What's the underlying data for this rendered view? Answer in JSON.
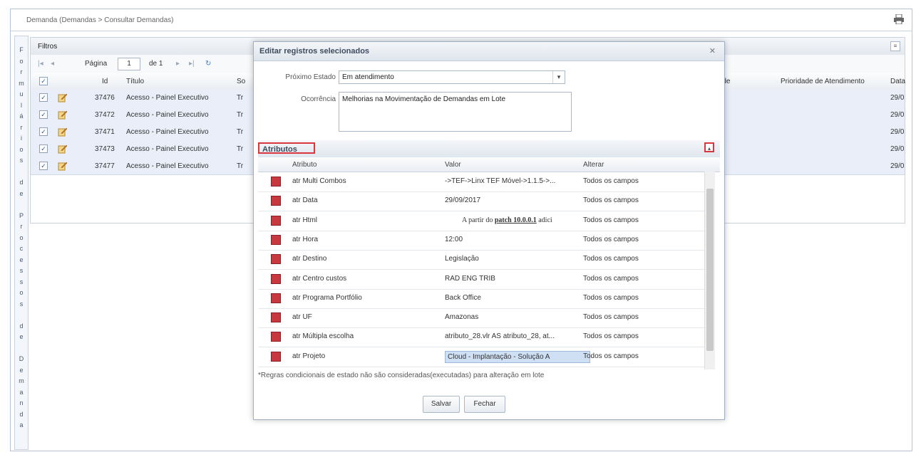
{
  "breadcrumb": "Demanda (Demandas > Consultar Demandas)",
  "vertical_label": [
    "F",
    "o",
    "r",
    "m",
    "u",
    "l",
    "á",
    "r",
    "i",
    "o",
    "s",
    "",
    "d",
    "e",
    "",
    "P",
    "r",
    "o",
    "c",
    "e",
    "s",
    "s",
    "o",
    "s",
    "",
    "d",
    "e",
    "",
    "D",
    "e",
    "m",
    "a",
    "n",
    "d",
    "a"
  ],
  "filters": {
    "title": "Filtros"
  },
  "paging": {
    "page_label": "Página",
    "page_value": "1",
    "of_label": "de 1"
  },
  "grid": {
    "headers": {
      "id": "Id",
      "title": "Título",
      "so": "So",
      "priority_short": "idade",
      "priority_attend": "Prioridade de Atendimento",
      "date": "Data"
    },
    "rows": [
      {
        "id": "37476",
        "title": "Acesso - Painel Executivo",
        "so": "Tr",
        "date": "29/0"
      },
      {
        "id": "37472",
        "title": "Acesso - Painel Executivo",
        "so": "Tr",
        "date": "29/0"
      },
      {
        "id": "37471",
        "title": "Acesso - Painel Executivo",
        "so": "Tr",
        "date": "29/0"
      },
      {
        "id": "37473",
        "title": "Acesso - Painel Executivo",
        "so": "Tr",
        "date": "29/0"
      },
      {
        "id": "37477",
        "title": "Acesso - Painel Executivo",
        "so": "Tr",
        "date": "29/0"
      }
    ]
  },
  "modal": {
    "title": "Editar registros selecionados",
    "next_state_label": "Próximo Estado",
    "next_state_value": "Em atendimento",
    "occurrence_label": "Ocorrência",
    "occurrence_value": "Melhorias na Movimentação de Demandas em Lote",
    "attributes_title": "Atributos",
    "attr_headers": {
      "attribute": "Atributo",
      "value": "Valor",
      "change": "Alterar"
    },
    "attr_rows": [
      {
        "attribute": "atr Multi Combos",
        "value": "->TEF->Linx TEF Móvel->1.1.5->...",
        "change": "Todos os campos"
      },
      {
        "attribute": "atr Data",
        "value": "29/09/2017",
        "change": "Todos os campos"
      },
      {
        "attribute": "atr Html",
        "value_prefix": "A partir do ",
        "value_bold": "patch 10.0.0.1",
        "value_suffix": " adici",
        "change": "Todos os campos"
      },
      {
        "attribute": "atr Hora",
        "value": "12:00",
        "change": "Todos os campos"
      },
      {
        "attribute": "atr Destino",
        "value": "Legislação",
        "change": "Todos os campos"
      },
      {
        "attribute": "atr Centro custos",
        "value": "RAD ENG TRIB",
        "change": "Todos os campos"
      },
      {
        "attribute": "atr Programa Portfólio",
        "value": "Back Office",
        "change": "Todos os campos"
      },
      {
        "attribute": "atr UF",
        "value": "Amazonas",
        "change": "Todos os campos"
      },
      {
        "attribute": "atr Múltipla escolha",
        "value": "atributo_28.vlr AS atributo_28, at...",
        "change": "Todos os campos"
      },
      {
        "attribute": "atr Projeto",
        "value": "Cloud - Implantação - Solução A",
        "change": "Todos os campos"
      }
    ],
    "footnote": "*Regras condicionais de estado não são consideradas(executadas) para alteração em lote",
    "save_label": "Salvar",
    "close_label": "Fechar"
  },
  "colors": {
    "highlight": "#d9363e",
    "row_selected": "#e9eef8",
    "delete_icon": "#c7393e"
  }
}
